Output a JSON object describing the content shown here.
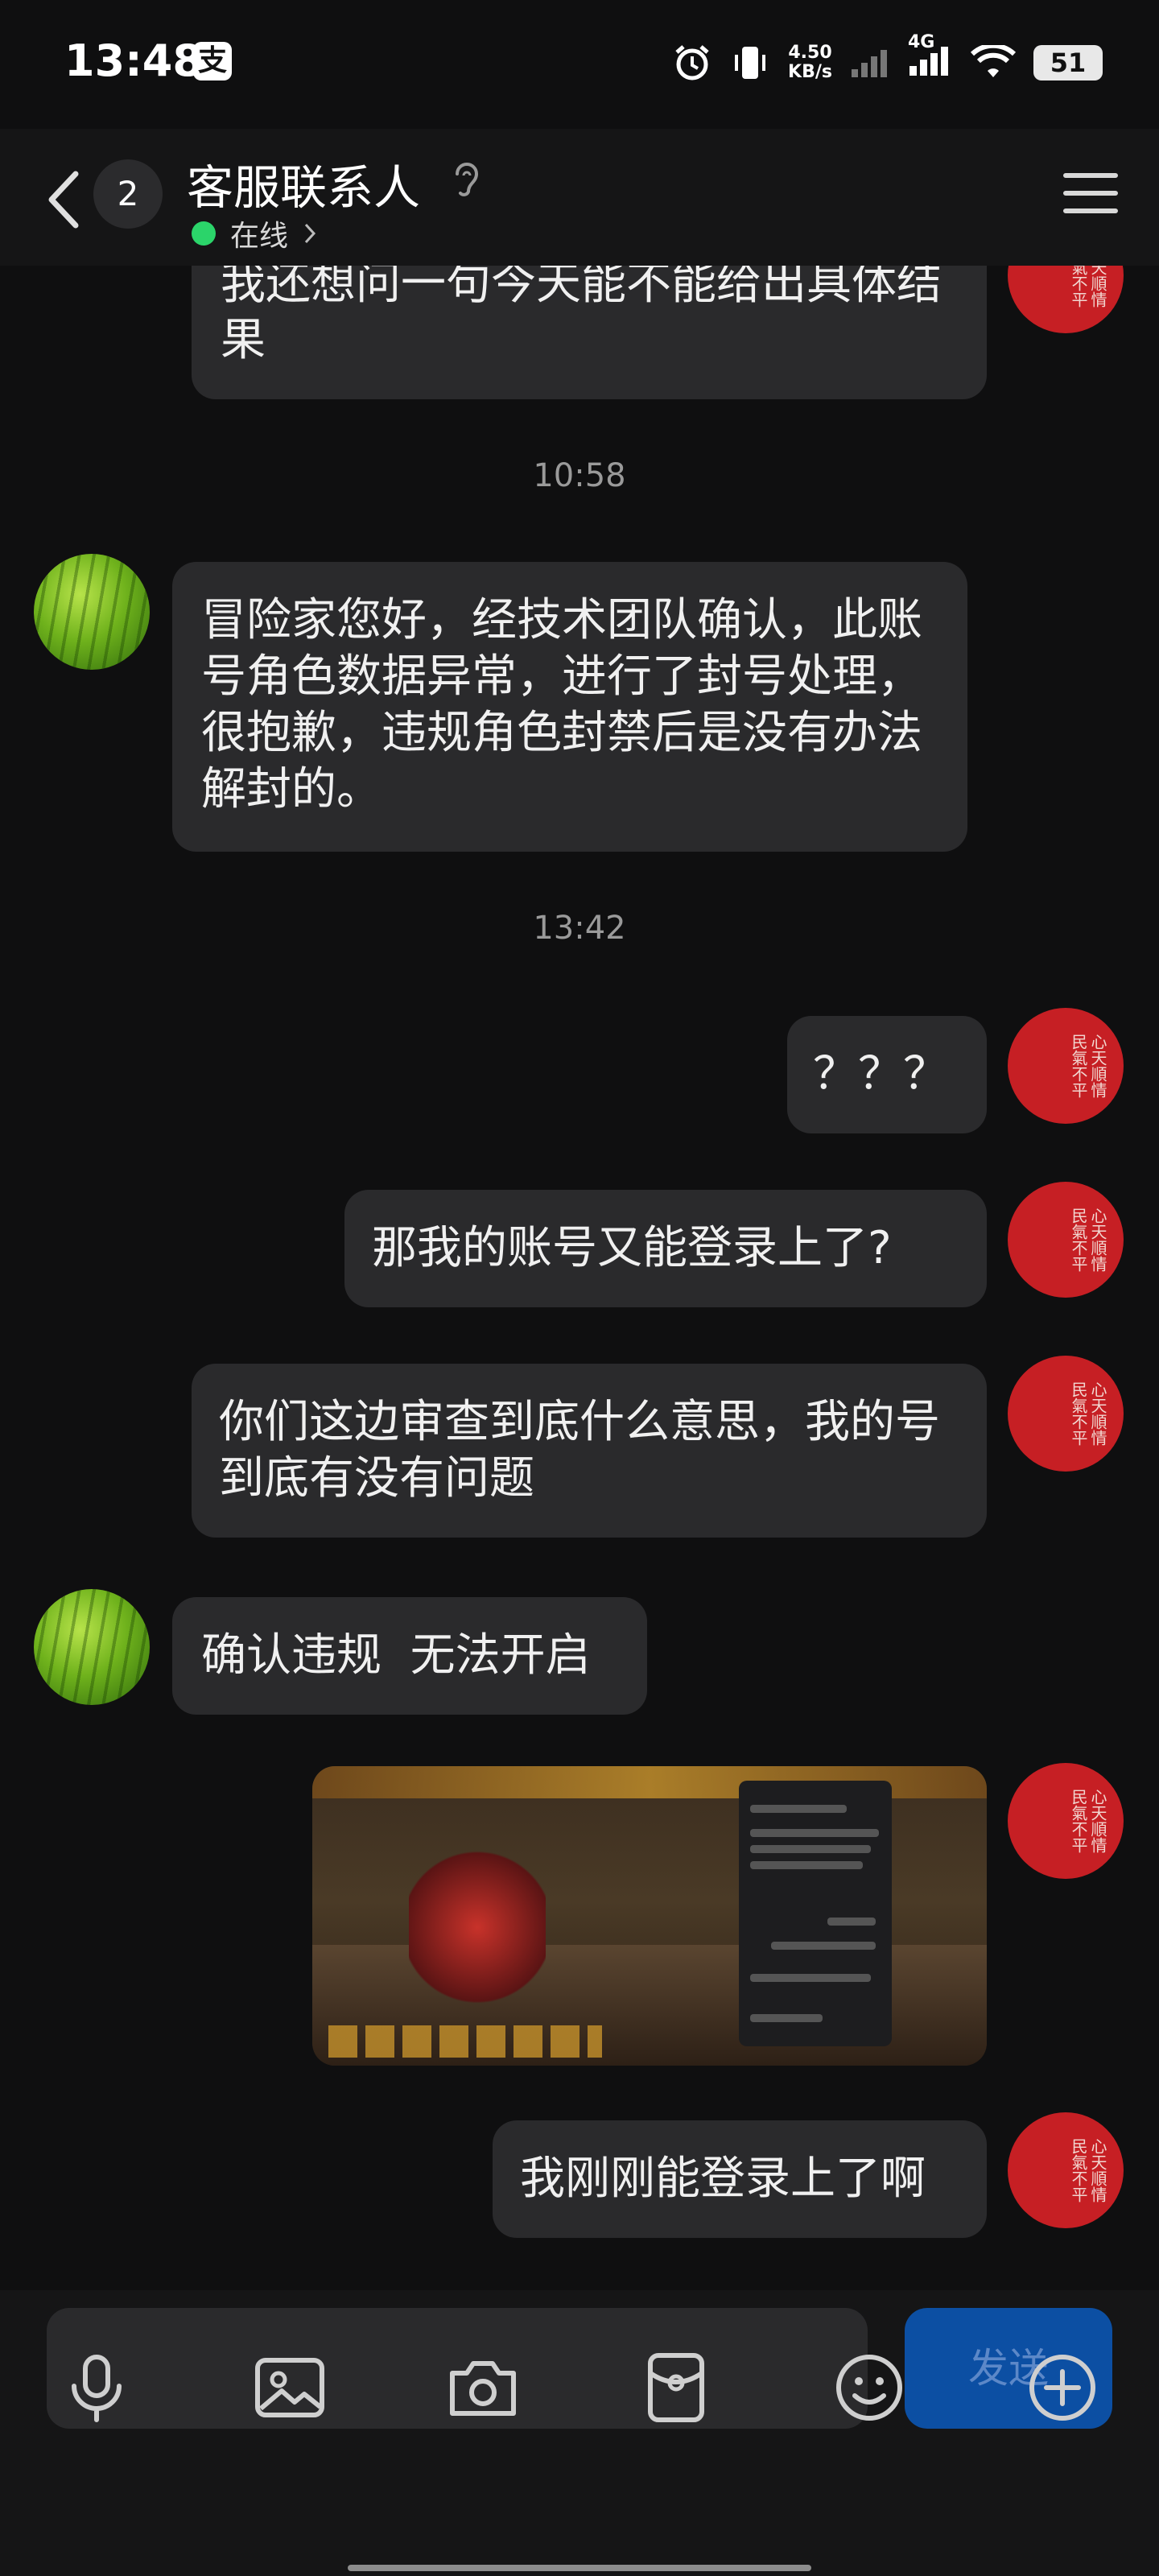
{
  "status_bar": {
    "time": "13:48",
    "app_icon": "支",
    "speed_value": "4.50",
    "speed_unit": "KB/s",
    "network": "4G",
    "battery": "51"
  },
  "header": {
    "unread_count": "2",
    "contact_name": "客服联系人",
    "status": "在线"
  },
  "messages": [
    {
      "text": "我还想问一句今天能不能给出具体结果"
    },
    {
      "time": "10:58"
    },
    {
      "text": "冒险家您好，经技术团队确认，此账号角色数据异常，进行了封号处理，很抱歉，违规角色封禁后是没有办法解封的。"
    },
    {
      "time": "13:42"
    },
    {
      "text": "？？？"
    },
    {
      "text": "那我的账号又能登录上了?"
    },
    {
      "text": "你们这边审查到底什么意思，我的号到底有没有问题"
    },
    {
      "text": "确认违规  无法开启"
    },
    {
      "text": "我刚刚能登录上了啊"
    }
  ],
  "input": {
    "send_label": "发送"
  },
  "toolbar": [
    "microphone-icon",
    "image-icon",
    "camera-icon",
    "red-packet-icon",
    "emoji-icon",
    "plus-icon"
  ],
  "colors": {
    "send_button": "#0c4fa3",
    "online": "#2bd46a",
    "my_avatar": "#c61f24"
  }
}
